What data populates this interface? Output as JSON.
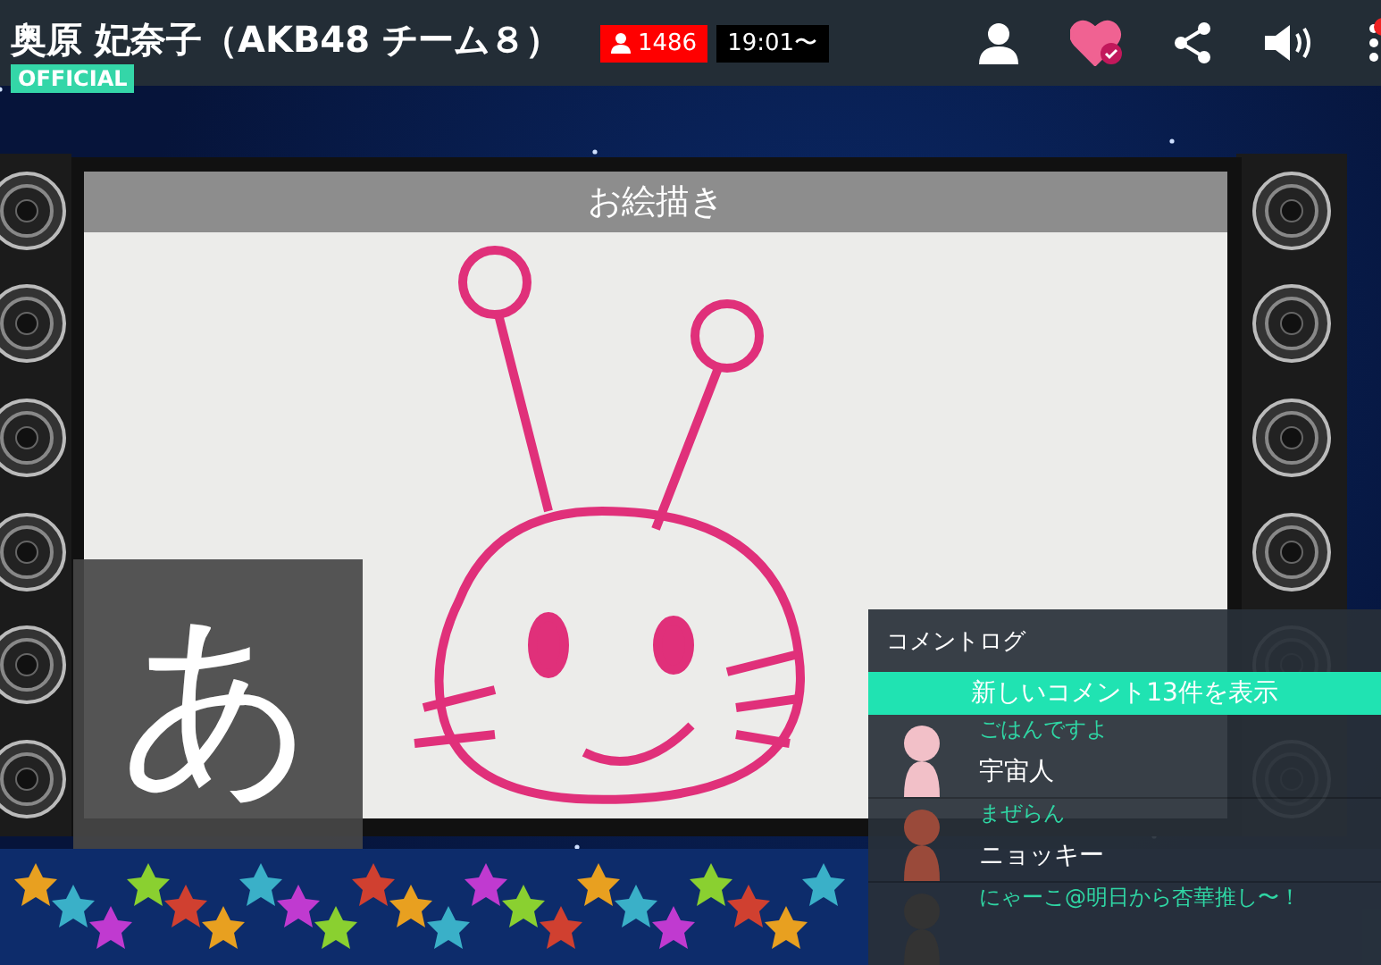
{
  "header": {
    "title": "奥原 妃奈子（AKB48 チーム８）",
    "badge": "OFFICIAL",
    "viewers": "1486",
    "start_time": "19:01〜",
    "favorite": true,
    "notification": true
  },
  "video": {
    "title": "お絵描き"
  },
  "input_overlay": {
    "character": "あ"
  },
  "comment_log": {
    "title": "コメントログ",
    "new_button": "新しいコメント13件を表示",
    "comments": [
      {
        "name": "ごはんですよ",
        "text": "宇宙人"
      },
      {
        "name": "まぜらん",
        "text": "ニョッキー"
      },
      {
        "name": "にゃーこ@明日から杏華推し〜！"
      }
    ]
  }
}
